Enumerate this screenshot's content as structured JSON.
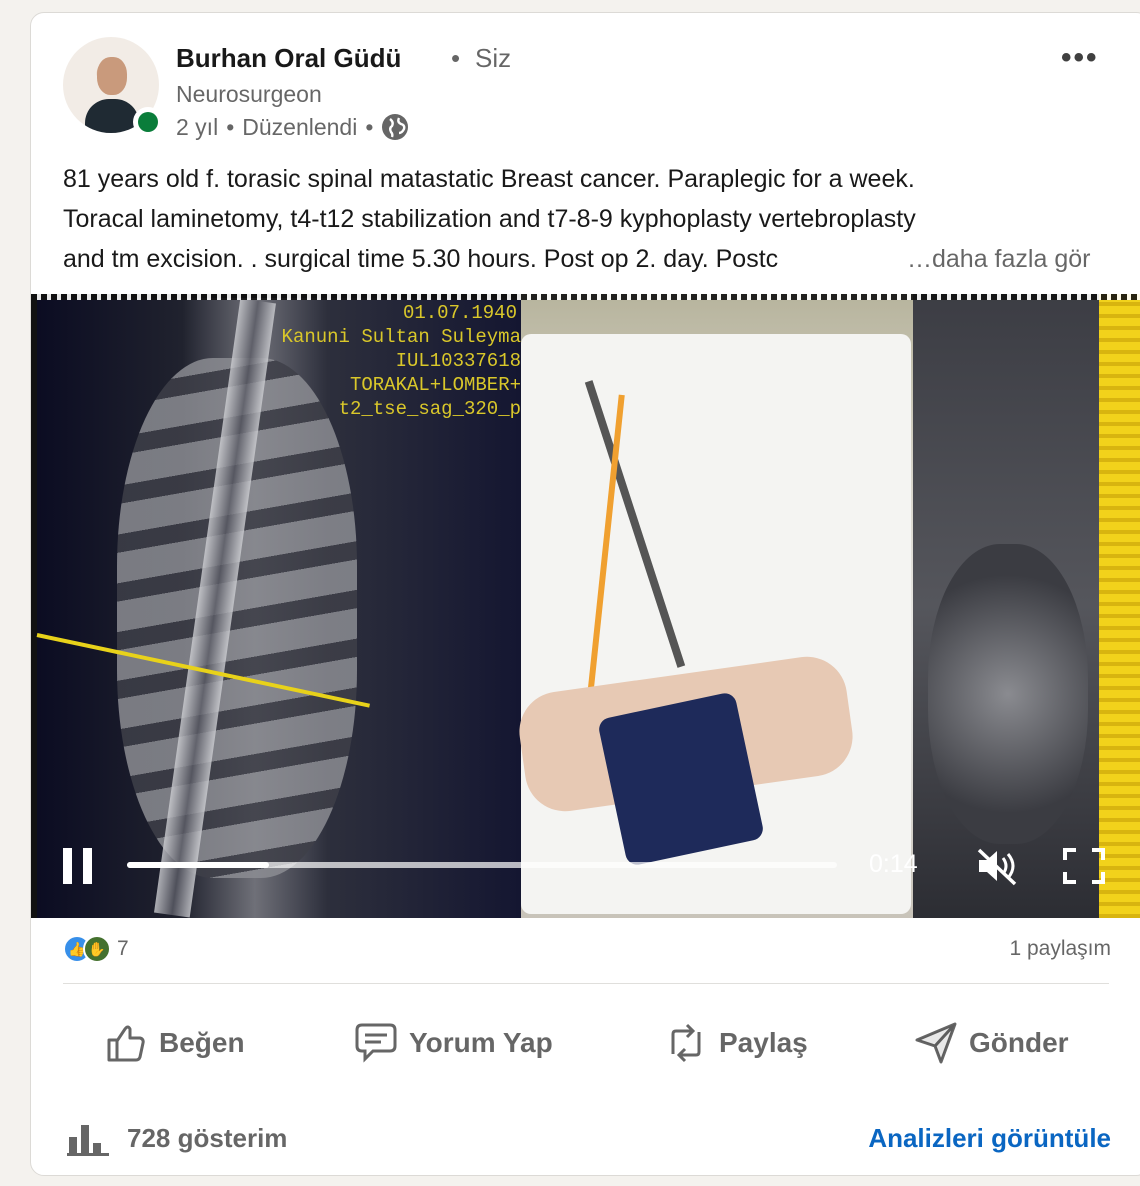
{
  "post": {
    "author": {
      "name": "Burhan Oral Güdü",
      "relation": "Siz",
      "headline": "Neurosurgeon",
      "time": "2 yıl",
      "edited": "Düzenlendi",
      "visibility_icon": "globe-icon",
      "presence_color": "#0a7d3a"
    },
    "menu_icon": "more-icon",
    "text_lines": [
      "81 years old f. torasic spinal matastatic Breast cancer. Paraplegic for a week.",
      "Toracal laminetomy, t4-t12 stabilization and t7-8-9 kyphoplasty vertebroplasty",
      "and tm excision. . surgical time 5.30 hours. Post op 2. day. Postc"
    ],
    "see_more": "…daha fazla gör"
  },
  "video": {
    "mri_overlay": [
      "01.07.1940",
      "Kanuni Sultan Suleyma",
      "IUL10337618",
      "TORAKAL+LOMBER+",
      "t2_tse_sag_320_p"
    ],
    "time": "0:14",
    "progress_fraction": 0.2,
    "controls": {
      "pause_icon": "pause-icon",
      "mute_icon": "volume-muted-icon",
      "fullscreen_icon": "fullscreen-icon"
    }
  },
  "social": {
    "reaction_count": "7",
    "shares": "1 paylaşım",
    "reaction_icons": [
      "like-icon",
      "support-icon"
    ]
  },
  "actions": [
    {
      "label": "Beğen",
      "icon": "like-icon"
    },
    {
      "label": "Yorum Yap",
      "icon": "comment-icon"
    },
    {
      "label": "Paylaş",
      "icon": "repost-icon"
    },
    {
      "label": "Gönder",
      "icon": "send-icon"
    }
  ],
  "analytics": {
    "impressions": "728 gösterim",
    "link": "Analizleri görüntüle",
    "icon": "bar-chart-icon"
  },
  "colors": {
    "accent": "#0a66c2",
    "like": "#378fe9",
    "support": "#44712e"
  }
}
